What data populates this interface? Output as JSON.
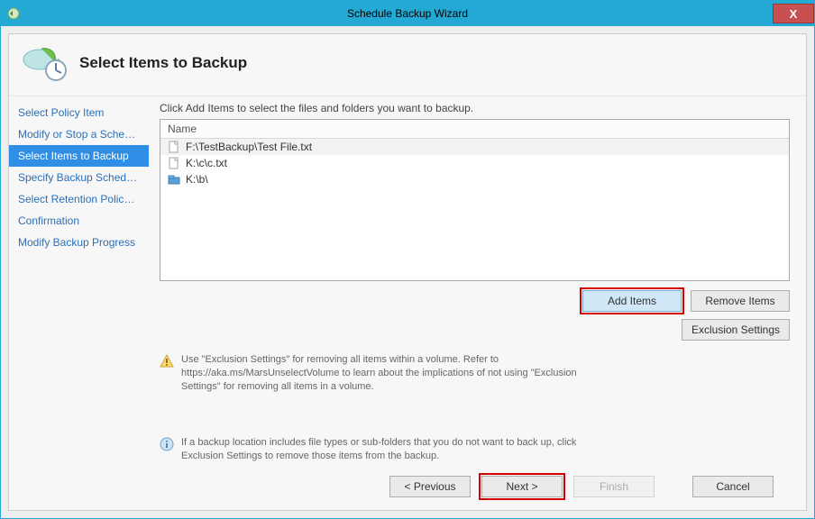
{
  "window": {
    "title": "Schedule Backup Wizard",
    "close": "X"
  },
  "page": {
    "heading": "Select Items to Backup"
  },
  "sidebar": {
    "items": [
      {
        "label": "Select Policy Item"
      },
      {
        "label": "Modify or Stop a Schedul..."
      },
      {
        "label": "Select Items to Backup"
      },
      {
        "label": "Specify Backup Schedule ..."
      },
      {
        "label": "Select Retention Policy (F..."
      },
      {
        "label": "Confirmation"
      },
      {
        "label": "Modify Backup Progress"
      }
    ],
    "active_index": 2
  },
  "main": {
    "instruction": "Click Add Items to select the files and folders you want to backup.",
    "list_header": "Name",
    "items": [
      {
        "type": "file",
        "label": "F:\\TestBackup\\Test File.txt"
      },
      {
        "type": "file",
        "label": "K:\\c\\c.txt"
      },
      {
        "type": "folder",
        "label": "K:\\b\\"
      }
    ],
    "buttons": {
      "add": "Add Items",
      "remove": "Remove Items",
      "exclusion": "Exclusion Settings"
    },
    "warning": "Use \"Exclusion Settings\" for removing all items within a volume. Refer to https://aka.ms/MarsUnselectVolume to learn about the implications of not using \"Exclusion Settings\" for removing all items in a volume.",
    "info": "If a backup location includes file types or sub-folders that you do not want to back up, click Exclusion Settings to remove those items from the backup."
  },
  "footer": {
    "previous": "< Previous",
    "next": "Next >",
    "finish": "Finish",
    "cancel": "Cancel"
  }
}
